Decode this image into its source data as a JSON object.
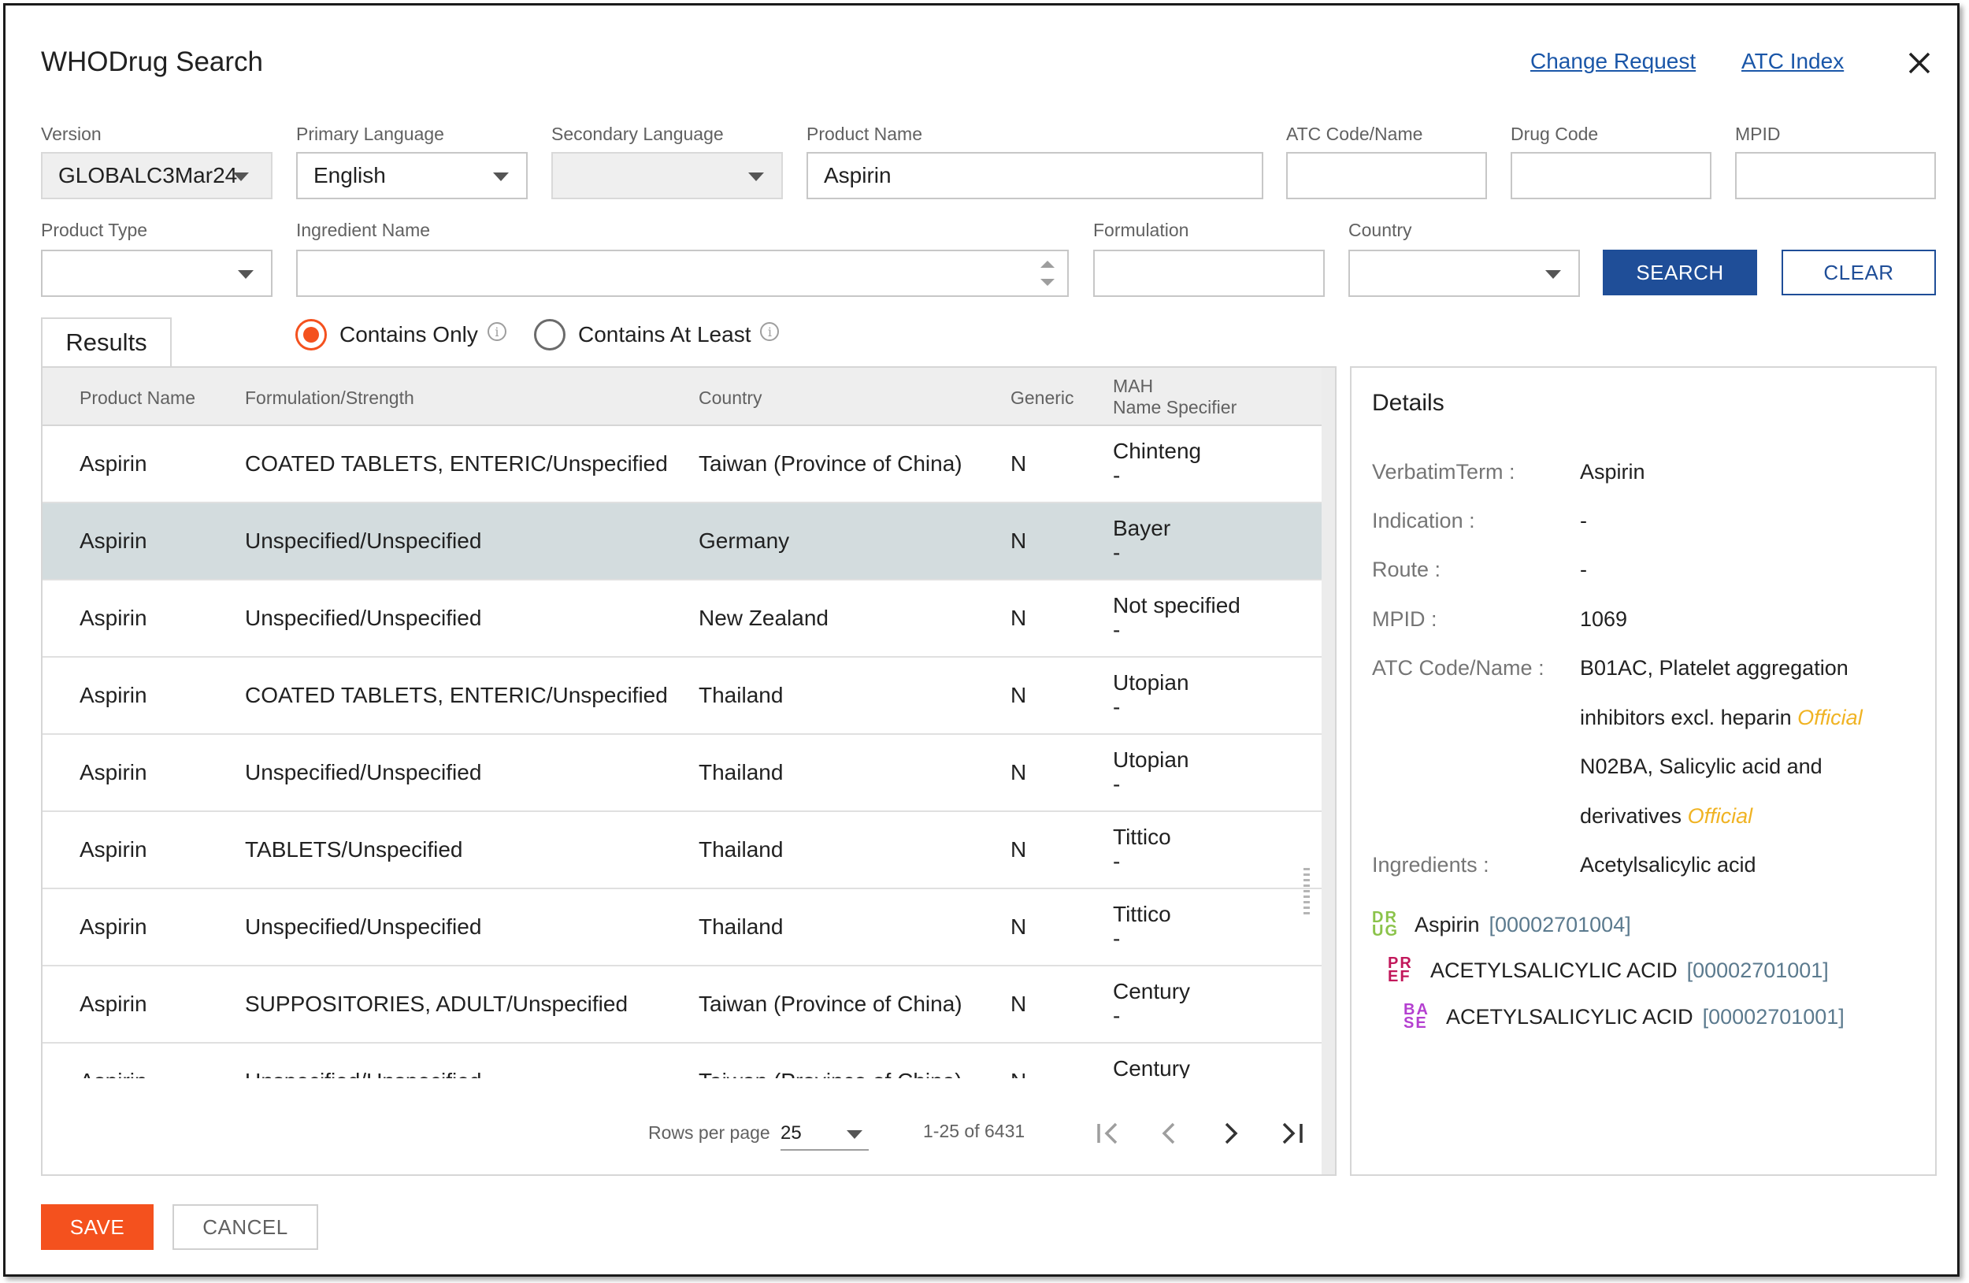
{
  "header": {
    "title": "WHODrug Search",
    "change_request": "Change Request",
    "atc_index": "ATC Index"
  },
  "filters": {
    "version": {
      "label": "Version",
      "value": "GLOBALC3Mar24"
    },
    "primary_language": {
      "label": "Primary Language",
      "value": "English"
    },
    "secondary_language": {
      "label": "Secondary Language",
      "value": ""
    },
    "product_name": {
      "label": "Product Name",
      "value": "Aspirin"
    },
    "atc_code": {
      "label": "ATC Code/Name",
      "value": ""
    },
    "drug_code": {
      "label": "Drug Code",
      "value": ""
    },
    "mpid": {
      "label": "MPID",
      "value": ""
    },
    "product_type": {
      "label": "Product Type",
      "value": ""
    },
    "ingredient_name": {
      "label": "Ingredient Name",
      "value": ""
    },
    "formulation": {
      "label": "Formulation",
      "value": ""
    },
    "country": {
      "label": "Country",
      "value": ""
    },
    "search_label": "SEARCH",
    "clear_label": "CLEAR"
  },
  "results_tab": "Results",
  "match_mode": {
    "contains_only": "Contains Only",
    "contains_at_least": "Contains At Least",
    "selected": "contains_only"
  },
  "table": {
    "headers": {
      "product": "Product Name",
      "formulation": "Formulation/Strength",
      "country": "Country",
      "generic": "Generic",
      "mah": "MAH",
      "name_specifier": "Name Specifier"
    },
    "selected_row": 1,
    "rows": [
      {
        "product": "Aspirin",
        "formulation": "COATED TABLETS, ENTERIC/Unspecified",
        "country": "Taiwan (Province of China)",
        "generic": "N",
        "mah": "Chinteng",
        "spec": "-"
      },
      {
        "product": "Aspirin",
        "formulation": "Unspecified/Unspecified",
        "country": "Germany",
        "generic": "N",
        "mah": "Bayer",
        "spec": "-"
      },
      {
        "product": "Aspirin",
        "formulation": "Unspecified/Unspecified",
        "country": "New Zealand",
        "generic": "N",
        "mah": "Not specified",
        "spec": "-"
      },
      {
        "product": "Aspirin",
        "formulation": "COATED TABLETS, ENTERIC/Unspecified",
        "country": "Thailand",
        "generic": "N",
        "mah": "Utopian",
        "spec": "-"
      },
      {
        "product": "Aspirin",
        "formulation": "Unspecified/Unspecified",
        "country": "Thailand",
        "generic": "N",
        "mah": "Utopian",
        "spec": "-"
      },
      {
        "product": "Aspirin",
        "formulation": "TABLETS/Unspecified",
        "country": "Thailand",
        "generic": "N",
        "mah": "Tittico",
        "spec": "-"
      },
      {
        "product": "Aspirin",
        "formulation": "Unspecified/Unspecified",
        "country": "Thailand",
        "generic": "N",
        "mah": "Tittico",
        "spec": "-"
      },
      {
        "product": "Aspirin",
        "formulation": "SUPPOSITORIES, ADULT/Unspecified",
        "country": "Taiwan (Province of China)",
        "generic": "N",
        "mah": "Century",
        "spec": "-"
      },
      {
        "product": "Aspirin",
        "formulation": "Unspecified/Unspecified",
        "country": "Taiwan (Province of China)",
        "generic": "N",
        "mah": "Century",
        "spec": "-"
      }
    ]
  },
  "pager": {
    "rows_per_page_label": "Rows per page",
    "rows_per_page": "25",
    "range": "1-25 of 6431"
  },
  "details": {
    "title": "Details",
    "verbatim_label": "VerbatimTerm :",
    "verbatim": "Aspirin",
    "indication_label": "Indication :",
    "indication": "-",
    "route_label": "Route :",
    "route": "-",
    "mpid_label": "MPID :",
    "mpid": "1069",
    "atc_label": "ATC Code/Name :",
    "atc_1a": "B01AC, Platelet aggregation",
    "atc_1b": "inhibitors excl. heparin",
    "atc_2a": "N02BA, Salicylic acid and",
    "atc_2b": "derivatives",
    "official": "Official",
    "ingredients_label": "Ingredients :",
    "ingredients": "Acetylsalicylic acid",
    "tree": [
      {
        "badge_top": "DR",
        "badge_bottom": "UG",
        "color": "#8bc34a",
        "name": "Aspirin",
        "code": "[00002701004]"
      },
      {
        "badge_top": "PR",
        "badge_bottom": "EF",
        "color": "#c2185b",
        "name": "ACETYLSALICYLIC ACID",
        "code": "[00002701001]"
      },
      {
        "badge_top": "BA",
        "badge_bottom": "SE",
        "color": "#b43fd0",
        "name": "ACETYLSALICYLIC ACID",
        "code": "[00002701001]"
      }
    ]
  },
  "footer": {
    "save_label": "SAVE",
    "cancel_label": "CANCEL"
  }
}
